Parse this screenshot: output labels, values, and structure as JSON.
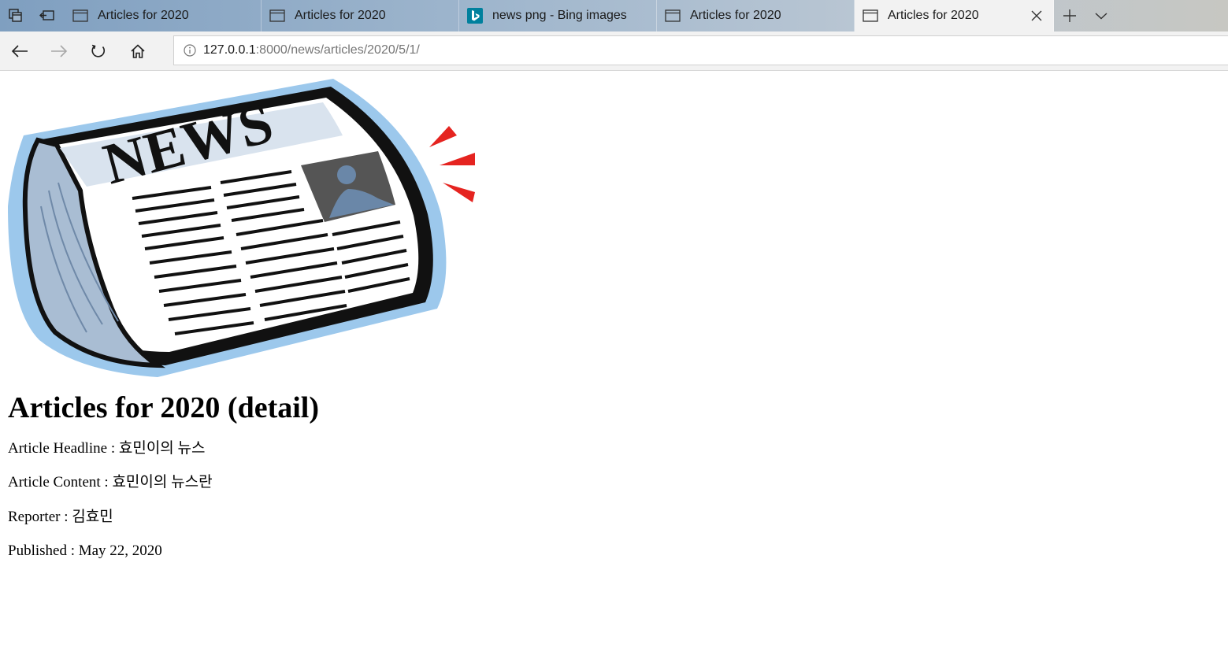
{
  "browser": {
    "tabs": [
      {
        "title": "Articles for 2020",
        "favicon": "page-icon",
        "active": false
      },
      {
        "title": "Articles for 2020",
        "favicon": "page-icon",
        "active": false
      },
      {
        "title": "news png - Bing images",
        "favicon": "bing-icon",
        "active": false
      },
      {
        "title": "Articles for 2020",
        "favicon": "page-icon",
        "active": false
      },
      {
        "title": "Articles for 2020",
        "favicon": "page-icon",
        "active": true
      }
    ],
    "url_host": "127.0.0.1",
    "url_path": ":8000/news/articles/2020/5/1/",
    "colors": {
      "bing_accent": "#00809d",
      "tab_active": "#f2f2f2"
    }
  },
  "page": {
    "image_logo_text": "NEWS",
    "title": "Articles for 2020 (detail)",
    "headline_label": "Article Headline : ",
    "headline": "효민이의 뉴스",
    "content_label": "Article Content : ",
    "content": "효민이의 뉴스란",
    "reporter_label": "Reporter : ",
    "reporter": "김효민",
    "published_label": "Published : ",
    "published": "May 22, 2020"
  }
}
